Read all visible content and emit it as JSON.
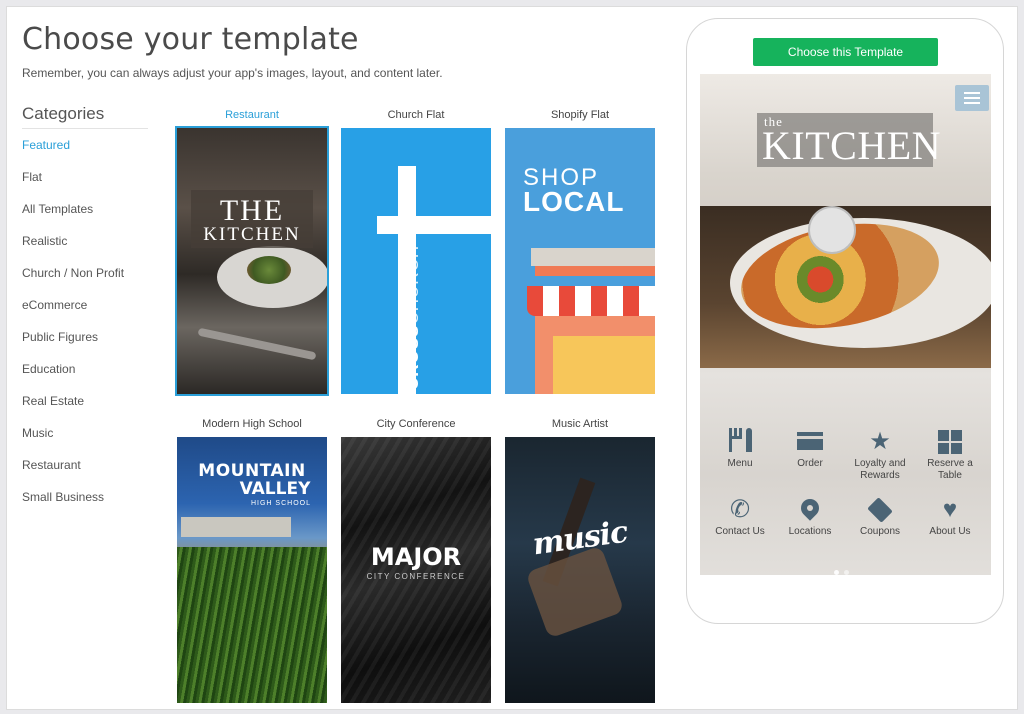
{
  "header": {
    "title": "Choose your template",
    "subtitle": "Remember, you can always adjust your app's images, layout, and content later."
  },
  "categories": {
    "heading": "Categories",
    "items": [
      {
        "label": "Featured",
        "active": true
      },
      {
        "label": "Flat"
      },
      {
        "label": "All Templates"
      },
      {
        "label": "Realistic"
      },
      {
        "label": "Church / Non Profit"
      },
      {
        "label": "eCommerce"
      },
      {
        "label": "Public Figures"
      },
      {
        "label": "Education"
      },
      {
        "label": "Real Estate"
      },
      {
        "label": "Music"
      },
      {
        "label": "Restaurant"
      },
      {
        "label": "Small Business"
      }
    ]
  },
  "templates": [
    {
      "name": "Restaurant",
      "selected": true,
      "thumb_text": [
        "THE",
        "KITCHEN"
      ]
    },
    {
      "name": "Church Flat",
      "thumb_text": [
        "CROSS",
        "CHURCH"
      ]
    },
    {
      "name": "Shopify Flat",
      "thumb_text": [
        "SHOP",
        "LOCAL"
      ]
    },
    {
      "name": "Modern High School",
      "thumb_text": [
        "MOUNTAIN",
        "VALLEY",
        "HIGH SCHOOL"
      ]
    },
    {
      "name": "City Conference",
      "thumb_text": [
        "MAJOR",
        "CITY CONFERENCE"
      ]
    },
    {
      "name": "Music Artist",
      "thumb_text": [
        "music"
      ]
    }
  ],
  "preview": {
    "choose_button": "Choose this Template",
    "logo_small": "the",
    "logo_main": "KITCHEN",
    "icons": [
      {
        "label": "Menu",
        "icon": "fork-knife-icon"
      },
      {
        "label": "Order",
        "icon": "credit-card-icon"
      },
      {
        "label": "Loyalty and Rewards",
        "icon": "star-icon"
      },
      {
        "label": "Reserve a Table",
        "icon": "grid-icon"
      },
      {
        "label": "Contact Us",
        "icon": "phone-icon"
      },
      {
        "label": "Locations",
        "icon": "map-pin-icon"
      },
      {
        "label": "Coupons",
        "icon": "tag-icon"
      },
      {
        "label": "About Us",
        "icon": "heart-icon"
      }
    ]
  },
  "colors": {
    "accent": "#2a9fd8",
    "button_green": "#16b35c",
    "icon": "#4b6475"
  }
}
